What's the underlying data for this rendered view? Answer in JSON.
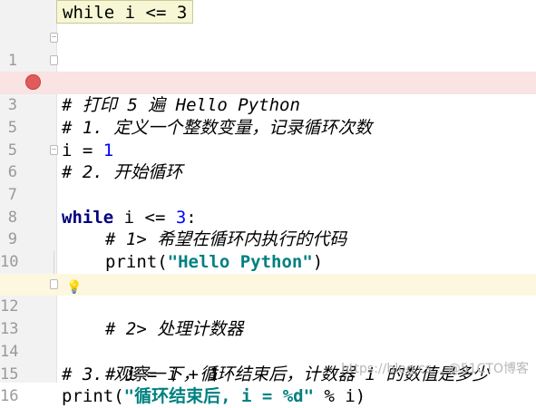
{
  "tooltip": "while i <= 3",
  "lines": [
    {
      "num": "1",
      "code": "# 打印 5 遍 Hello Python"
    },
    {
      "num": "2",
      "code": "# 1. 定义一个整数变量，记录循环次数"
    },
    {
      "num": "3",
      "code_a": "i = ",
      "code_b": "1"
    },
    {
      "num": "5"
    },
    {
      "num": "5",
      "code": "# 2. 开始循环"
    },
    {
      "num": "6",
      "code_a": "while",
      "code_b": " i <= ",
      "code_c": "3",
      "code_d": ":"
    },
    {
      "num": "7"
    },
    {
      "num": "8",
      "code": "# 1> 希望在循环内执行的代码"
    },
    {
      "num": "9",
      "code_a": "print(",
      "code_b": "\"Hello Python\"",
      "code_c": ")"
    },
    {
      "num": "10"
    },
    {
      "num": "11",
      "code": "# 2> 处理计数器"
    },
    {
      "num": "12",
      "code": "# i = i + 1"
    },
    {
      "num": "13"
    },
    {
      "num": "14",
      "code": "# 3. 观察一下，循环结束后，计数器 i 的数值是多少"
    },
    {
      "num": "15",
      "code_a": "print(",
      "code_b": "\"循环结束后, i = %d\"",
      "code_c": " % i)"
    },
    {
      "num": "16"
    }
  ],
  "watermark": "https://blog.cs... @51CTO博客",
  "colors": {
    "breakpoint": "#e15b5b",
    "breakpoint_line": "#fae3e3",
    "current_line": "#fdf7df",
    "comment": "#808080",
    "keyword": "#000080",
    "number": "#0000ff",
    "string": "#008080"
  },
  "icons": {
    "breakpoint": "breakpoint-icon",
    "fold": "fold-marker-icon",
    "intention": "lightbulb-icon"
  }
}
